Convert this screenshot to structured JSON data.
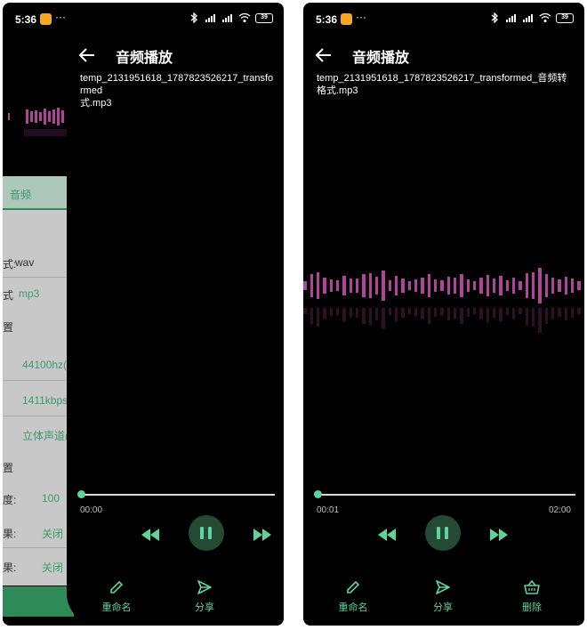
{
  "status_bar": {
    "time": "5:36",
    "dots": "···",
    "battery": "39"
  },
  "background_app": {
    "tab_label": "音频",
    "rows": [
      {
        "label": "式:",
        "value": "wav"
      },
      {
        "label": "式",
        "value": "mp3"
      },
      {
        "label": "置",
        "value": ""
      },
      {
        "label": "",
        "value": "44100hz("
      },
      {
        "label": "",
        "value": "1411kbps("
      },
      {
        "label": "",
        "value": "立体声道("
      },
      {
        "label": "置",
        "value": ""
      },
      {
        "label": "度:",
        "value": "100"
      },
      {
        "label": "果:",
        "value": "关闭"
      },
      {
        "label": "果:",
        "value": "关闭"
      }
    ]
  },
  "screens": [
    {
      "title": "音频播放",
      "filename": "temp_2131951618_1787823526217_transformed\n式.mp3",
      "current_time": "00:00",
      "total_time": "",
      "progress": 0.0,
      "actions": [
        {
          "icon": "pencil-icon",
          "label": "重命名"
        },
        {
          "icon": "share-icon",
          "label": "分享"
        }
      ]
    },
    {
      "title": "音频播放",
      "filename": "temp_2131951618_1787823526217_transformed_音频转格式.mp3",
      "current_time": "00:01",
      "total_time": "02:00",
      "progress": 0.0,
      "actions": [
        {
          "icon": "pencil-icon",
          "label": "重命名"
        },
        {
          "icon": "share-icon",
          "label": "分享"
        },
        {
          "icon": "basket-icon",
          "label": "删除"
        }
      ]
    }
  ],
  "colors": {
    "accent": "#5fd39e",
    "accent_dark": "#244a36",
    "wave": "#b0449a",
    "background": "#000000"
  }
}
